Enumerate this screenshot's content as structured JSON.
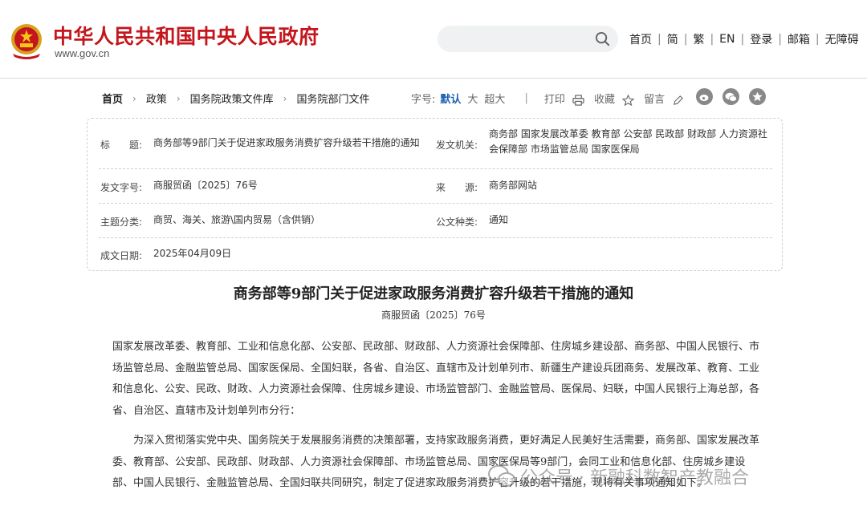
{
  "header": {
    "site_title": "中华人民共和国中央人民政府",
    "site_domain": "www.gov.cn",
    "search_placeholder": "",
    "nav": [
      "首页",
      "简",
      "繁",
      "EN",
      "登录",
      "邮箱",
      "无障碍"
    ]
  },
  "breadcrumb": {
    "items": [
      "首页",
      "政策",
      "国务院政策文件库",
      "国务院部门文件"
    ]
  },
  "tools": {
    "font_label": "字号:",
    "font_default": "默认",
    "font_large": "大",
    "font_xlarge": "超大",
    "print": "打印",
    "favorite": "收藏",
    "comment": "留言"
  },
  "share_icons": [
    "weibo-icon",
    "wechat-icon",
    "qzone-icon"
  ],
  "info": {
    "title_label": "标　　题:",
    "title_value": "商务部等9部门关于促进家政服务消费扩容升级若干措施的通知",
    "issuer_label": "发文机关:",
    "issuer_value": "商务部 国家发展改革委 教育部 公安部 民政部 财政部 人力资源社会保障部 市场监管总局 国家医保局",
    "docno_label": "发文字号:",
    "docno_value": "商服贸函〔2025〕76号",
    "source_label": "来　　源:",
    "source_value": "商务部网站",
    "category_label": "主题分类:",
    "category_value": "商贸、海关、旅游\\国内贸易（含供销）",
    "type_label": "公文种类:",
    "type_value": "通知",
    "date_label": "成文日期:",
    "date_value": "2025年04月09日"
  },
  "article": {
    "title": "商务部等9部门关于促进家政服务消费扩容升级若干措施的通知",
    "doc_number": "商服贸函〔2025〕76号",
    "recipients": "国家发展改革委、教育部、工业和信息化部、公安部、民政部、财政部、人力资源社会保障部、住房城乡建设部、商务部、中国人民银行、市场监管总局、金融监管总局、国家医保局、全国妇联，各省、自治区、直辖市及计划单列市、新疆生产建设兵团商务、发展改革、教育、工业和信息化、公安、民政、财政、人力资源社会保障、住房城乡建设、市场监管部门、金融监管局、医保局、妇联，中国人民银行上海总部，各省、自治区、直辖市及计划单列市分行：",
    "body1": "为深入贯彻落实党中央、国务院关于发展服务消费的决策部署，支持家政服务消费，更好满足人民美好生活需要，商务部、国家发展改革委、教育部、公安部、民政部、财政部、人力资源社会保障部、市场监管总局、国家医保局等9部门，会同工业和信息化部、住房城乡建设部、中国人民银行、金融监管总局、全国妇联共同研究，制定了促进家政服务消费扩容升级的若干措施，现将有关事项通知如下。"
  },
  "watermark": {
    "text": "公众号 · 新融科数智产教融合"
  },
  "colors": {
    "brand_red": "#c4161c",
    "active_blue": "#1a5fb4"
  }
}
